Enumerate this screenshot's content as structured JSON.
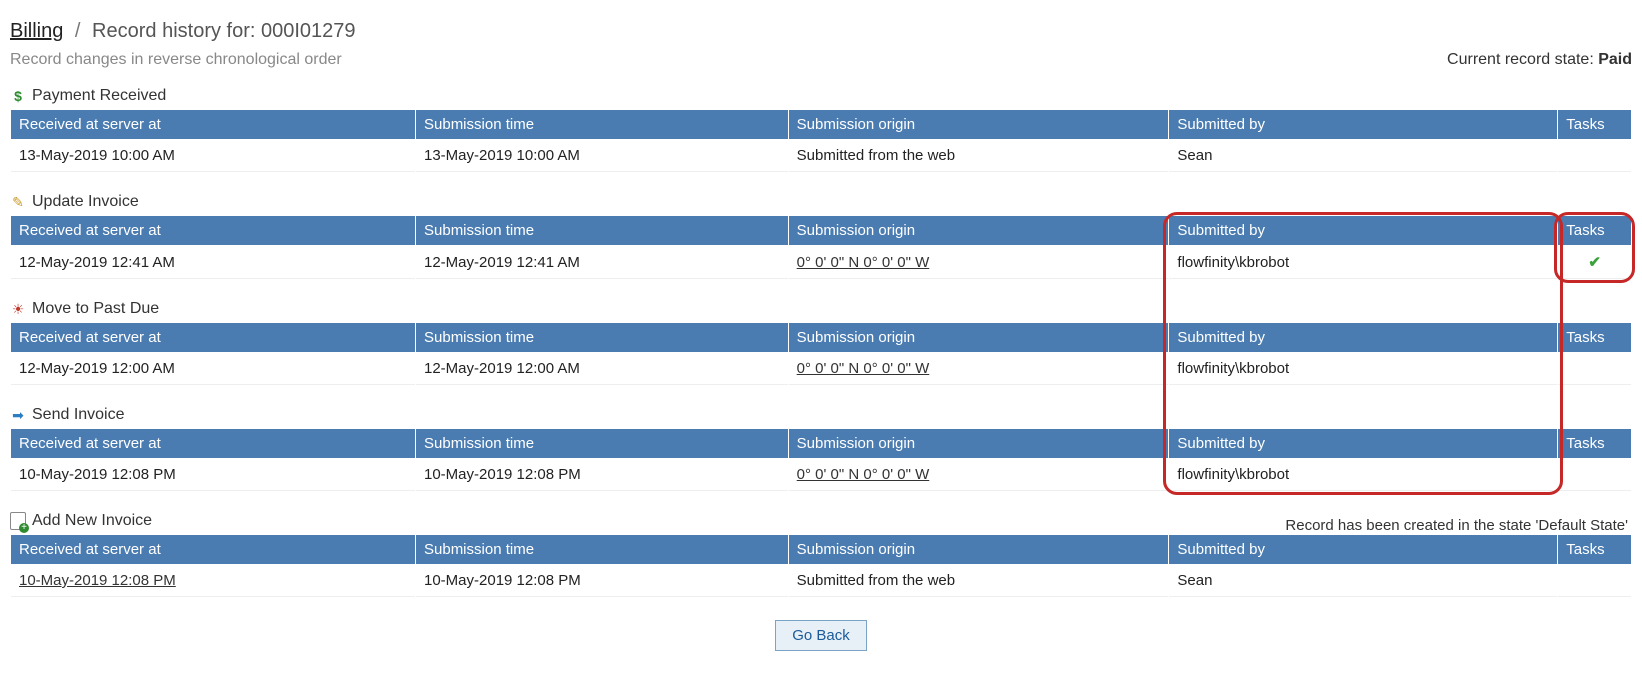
{
  "breadcrumb": {
    "root": "Billing",
    "page": "Record history for: 000I01279"
  },
  "subhead": "Record changes in reverse chronological order",
  "state_prefix": "Current record state: ",
  "state_value": "Paid",
  "headers": {
    "received": "Received at server at",
    "submission_time": "Submission time",
    "submission_origin": "Submission origin",
    "submitted_by": "Submitted by",
    "tasks": "Tasks"
  },
  "sections": [
    {
      "icon": "dollar-icon",
      "title": "Payment Received",
      "row": {
        "received": "13-May-2019 10:00 AM",
        "submission_time": "13-May-2019 10:00 AM",
        "origin": "Submitted from the web",
        "origin_is_link": false,
        "submitted_by": "Sean",
        "task": ""
      }
    },
    {
      "icon": "pencil-icon",
      "title": "Update Invoice",
      "row": {
        "received": "12-May-2019 12:41 AM",
        "submission_time": "12-May-2019 12:41 AM",
        "origin": "0° 0' 0\" N   0° 0' 0\" W",
        "origin_is_link": true,
        "submitted_by": "flowfinity\\kbrobot",
        "task": "check"
      },
      "highlight_submitted_by": true,
      "highlight_tasks": true
    },
    {
      "icon": "alarm-icon",
      "title": "Move to Past Due",
      "row": {
        "received": "12-May-2019 12:00 AM",
        "submission_time": "12-May-2019 12:00 AM",
        "origin": "0° 0' 0\" N   0° 0' 0\" W",
        "origin_is_link": true,
        "submitted_by": "flowfinity\\kbrobot",
        "task": ""
      },
      "highlight_submitted_by": true
    },
    {
      "icon": "arrow-icon",
      "title": "Send Invoice",
      "row": {
        "received": "10-May-2019 12:08 PM",
        "submission_time": "10-May-2019 12:08 PM",
        "origin": "0° 0' 0\" N   0° 0' 0\" W",
        "origin_is_link": true,
        "submitted_by": "flowfinity\\kbrobot",
        "task": ""
      },
      "highlight_submitted_by": true
    },
    {
      "icon": "add-doc-icon",
      "title": "Add New Invoice",
      "note": "Record has been created in the state 'Default State'",
      "row": {
        "received": "10-May-2019 12:08 PM",
        "received_is_link": true,
        "submission_time": "10-May-2019 12:08 PM",
        "origin": "Submitted from the web",
        "origin_is_link": false,
        "submitted_by": "Sean",
        "task": ""
      }
    }
  ],
  "go_back": "Go Back",
  "highlight_span": {
    "from_section": 1,
    "to_section": 3
  }
}
